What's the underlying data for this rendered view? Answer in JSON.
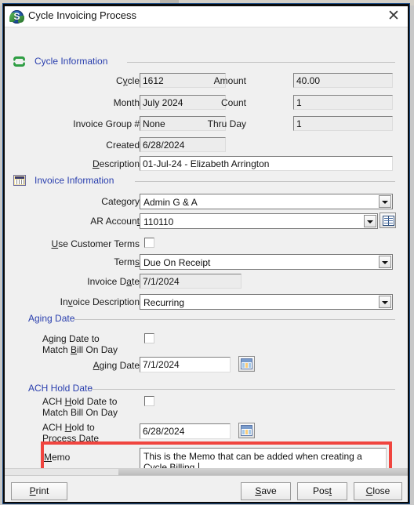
{
  "window": {
    "title": "Cycle Invoicing Process",
    "app_icon": "sage-s-icon",
    "close_label": "✕"
  },
  "sections": {
    "cycle_information": {
      "title": "Cycle Information",
      "icon": "recycle-icon"
    },
    "invoice_information": {
      "title": "Invoice Information",
      "icon": "document-icon"
    },
    "aging_date": {
      "title": "Aging Date"
    },
    "ach_hold_date": {
      "title": "ACH Hold Date"
    }
  },
  "cycle": {
    "cycle": {
      "label_pre": "C",
      "label_key": "y",
      "label_post": "cle",
      "label": "Cycle",
      "value": "1612"
    },
    "month": {
      "label": "Month",
      "value": "July 2024"
    },
    "invoice_group": {
      "label": "Invoice Group #",
      "value": "None"
    },
    "created": {
      "label": "Created",
      "value": "6/28/2024"
    },
    "description": {
      "label": "Description",
      "value": "01-Jul-24 - Elizabeth Arrington"
    },
    "amount": {
      "label": "Amount",
      "value": "40.00"
    },
    "count": {
      "label": "Count",
      "value": "1"
    },
    "thru_day": {
      "label": "Thru Day",
      "value": "1"
    }
  },
  "invoice": {
    "category": {
      "label": "Category",
      "value": "Admin G & A"
    },
    "ar_account": {
      "label": "AR Account",
      "value": "110110",
      "lookup_icon": "book-lookup-icon"
    },
    "use_customer_terms": {
      "label": "Use Customer Terms",
      "checked": false
    },
    "terms": {
      "label": "Terms",
      "value": "Due On Receipt"
    },
    "invoice_date": {
      "label": "Invoice Date",
      "value": "7/1/2024"
    },
    "invoice_description": {
      "label": "Invoice Description",
      "value": "Recurring"
    }
  },
  "aging": {
    "match_bill_on_day": {
      "label_line1": "Aging Date to",
      "label_line2": "Match Bill On Day",
      "checked": false
    },
    "aging_date": {
      "label": "Aging Date",
      "value": "7/1/2024",
      "picker_icon": "calendar-icon"
    }
  },
  "ach": {
    "match_bill_on_day": {
      "label_line1": "ACH Hold Date to",
      "label_line2": "Match Bill On Day",
      "checked": false
    },
    "hold_to_process_date": {
      "label_line1": "ACH Hold to",
      "label_line2": "Process Date",
      "value": "6/28/2024",
      "picker_icon": "calendar-icon"
    }
  },
  "memo": {
    "label": "Memo",
    "value": "This is the Memo that can be added when creating a Cycle Billing.",
    "highlight_color": "#f0453f"
  },
  "buttons": {
    "print": "Print",
    "save": "Save",
    "post": "Post",
    "close": "Close"
  },
  "colors": {
    "section_header": "#2a3fae",
    "highlight": "#f0453f",
    "window_bg": "#f0f0f0"
  }
}
